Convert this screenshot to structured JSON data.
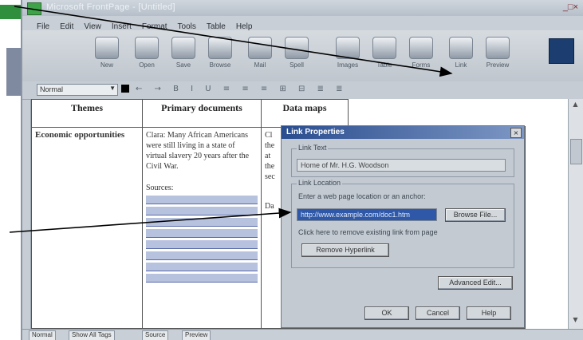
{
  "window": {
    "title": "Microsoft FrontPage - [Untitled]",
    "controls": "_□×",
    "menu": [
      "File",
      "Edit",
      "View",
      "Insert",
      "Format",
      "Tools",
      "Table",
      "Help"
    ]
  },
  "toolbar": {
    "buttons": [
      {
        "label": "New",
        "icon": "new-page-icon"
      },
      {
        "label": "Open",
        "icon": "open-folder-icon"
      },
      {
        "label": "Save",
        "icon": "save-icon"
      },
      {
        "label": "Browse",
        "icon": "globe-icon"
      },
      {
        "label": "Mail",
        "icon": "mail-icon"
      },
      {
        "label": "Spell",
        "icon": "spell-icon"
      },
      {
        "label": "Images",
        "icon": "image-icon"
      },
      {
        "label": "Table",
        "icon": "table-icon"
      },
      {
        "label": "Forms",
        "icon": "form-icon"
      },
      {
        "label": "Link",
        "icon": "link-icon"
      },
      {
        "label": "Preview",
        "icon": "preview-icon"
      }
    ],
    "style_select": "Normal",
    "format_icons": "← → B I U ≡ ≡ ≡ ⊞ ⊟ ≣ ≣"
  },
  "document": {
    "headers": [
      "Themes",
      "Primary documents",
      "Data maps"
    ],
    "theme": "Economic opportunities",
    "primary_text": "Clara: Many African Americans were still living in a state of virtual slavery 20 years after the Civil War.",
    "primary_link_label": "Sources:",
    "data_col_text": [
      "Cl",
      "the",
      "at",
      "the",
      "sec",
      "Da"
    ]
  },
  "dialog": {
    "title": "Link Properties",
    "close": "×",
    "link_text_label": "Link Text",
    "link_text_value": "Home of Mr. H.G. Woodson",
    "link_location_label": "Link Location",
    "location_instruction": "Enter a web page location or an anchor:",
    "location_value": "http://www.example.com/doc1.htm",
    "browse_button": "Browse File...",
    "checkbox_text": "Click here to remove existing link from page",
    "remove_button": "Remove Hyperlink",
    "advanced_button": "Advanced Edit...",
    "ok_button": "OK",
    "cancel_button": "Cancel",
    "help_button": "Help"
  },
  "status_tabs": [
    "Normal",
    "Show All Tags",
    "Source",
    "Preview"
  ],
  "colors": {
    "selection": "#2f59a8",
    "title_gradient_start": "#2a4d8f",
    "arrow": "#000000"
  }
}
